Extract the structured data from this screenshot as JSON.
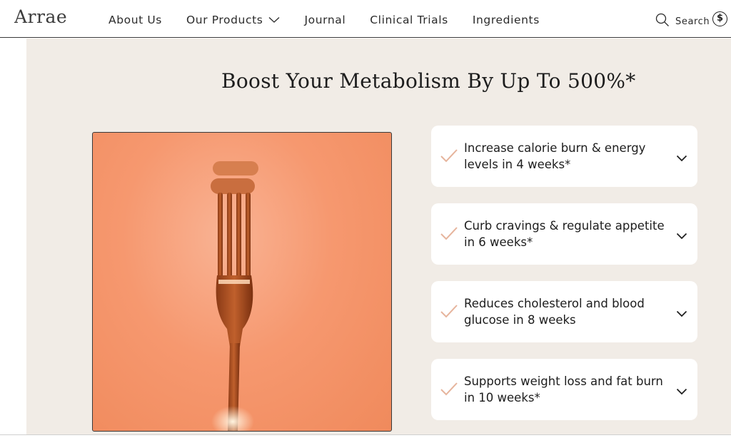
{
  "header": {
    "logo": "Arrae",
    "nav": [
      {
        "label": "About Us"
      },
      {
        "label": "Our Products",
        "has_dropdown": true
      },
      {
        "label": "Journal"
      },
      {
        "label": "Clinical Trials"
      },
      {
        "label": "Ingredients"
      }
    ],
    "search_label": "Search",
    "currency_symbol": "$"
  },
  "main": {
    "title": "Boost Your Metabolism By Up To 500%*",
    "benefits": [
      {
        "text": "Increase calorie burn & energy levels in 4 weeks*"
      },
      {
        "text": "Curb cravings & regulate appetite in 6 weeks*"
      },
      {
        "text": "Reduces cholesterol and blood glucose in 8 weeks"
      },
      {
        "text": "Supports weight loss and fat burn in 10 weeks*"
      }
    ]
  },
  "colors": {
    "section_bg": "#f1ece6",
    "check": "#e6b49c",
    "hero_bg": "#f6986f"
  }
}
